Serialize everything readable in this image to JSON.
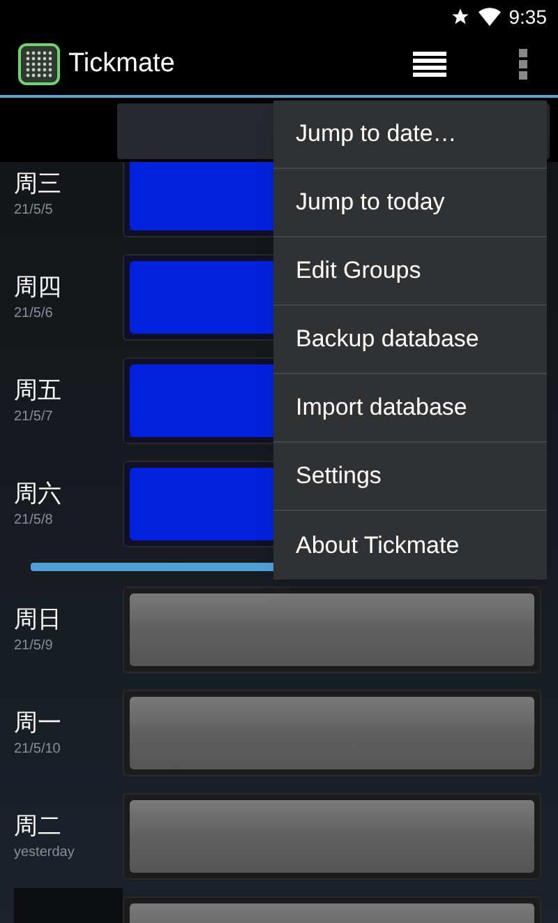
{
  "status_bar": {
    "time": "9:35"
  },
  "app_bar": {
    "title": "Tickmate"
  },
  "days": [
    {
      "weekday": "周三",
      "date": "21/5/5",
      "selected": true
    },
    {
      "weekday": "周四",
      "date": "21/5/6",
      "selected": true
    },
    {
      "weekday": "周五",
      "date": "21/5/7",
      "selected": true
    },
    {
      "weekday": "周六",
      "date": "21/5/8",
      "selected": true
    },
    {
      "weekday": "周日",
      "date": "21/5/9",
      "selected": false
    },
    {
      "weekday": "周一",
      "date": "21/5/10",
      "selected": false
    },
    {
      "weekday": "周二",
      "date": "yesterday",
      "selected": false
    }
  ],
  "menu": [
    "Jump to date…",
    "Jump to today",
    "Edit Groups",
    "Backup database",
    "Import database",
    "Settings",
    "About Tickmate"
  ]
}
